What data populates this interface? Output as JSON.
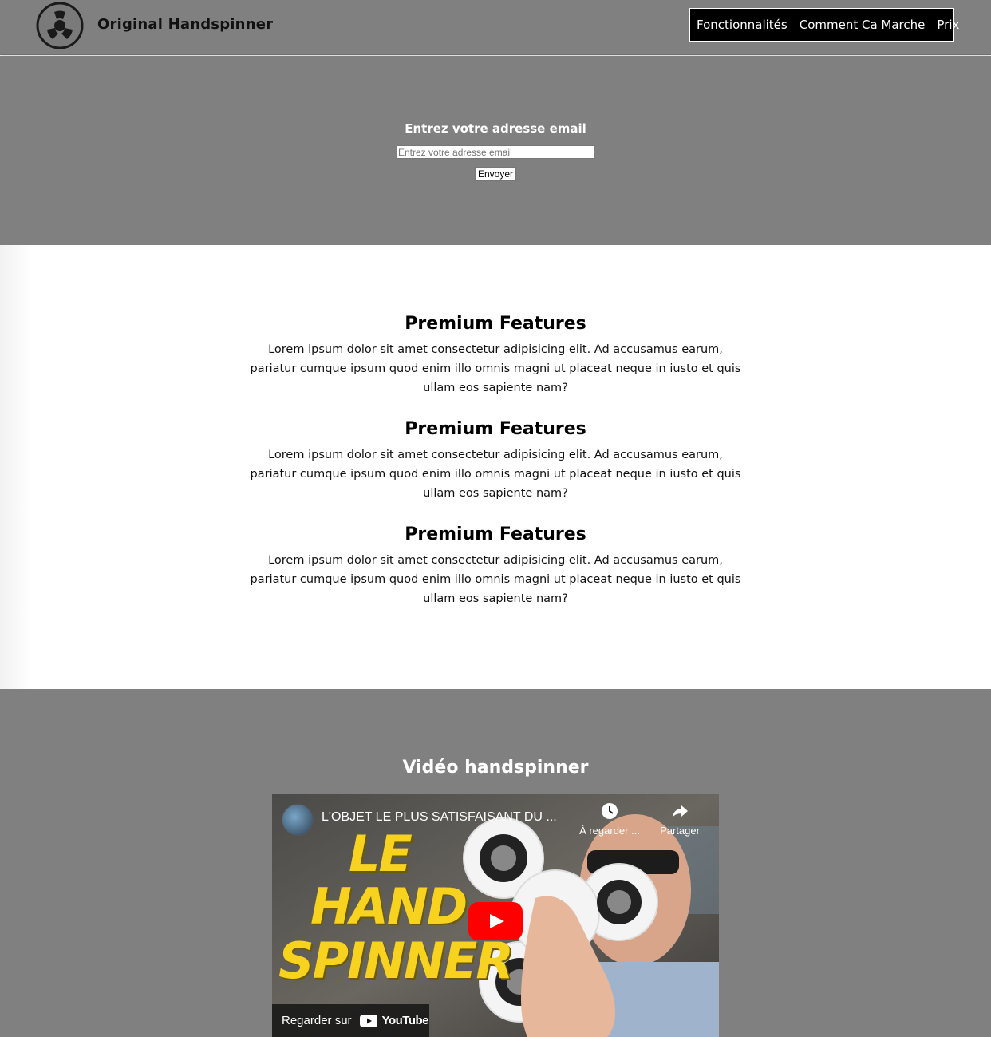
{
  "header": {
    "brand": "Original Handspinner",
    "nav": [
      "Fonctionnalités",
      "Comment Ca Marche",
      "Prix"
    ]
  },
  "hero": {
    "label": "Entrez votre adresse email",
    "input_placeholder": "Entrez votre adresse email",
    "submit_label": "Envoyer"
  },
  "features": [
    {
      "title": "Premium Features",
      "text": "Lorem ipsum dolor sit amet consectetur adipisicing elit. Ad accusamus earum, pariatur cumque ipsum quod enim illo omnis magni ut placeat neque in iusto et quis ullam eos sapiente nam?"
    },
    {
      "title": "Premium Features",
      "text": "Lorem ipsum dolor sit amet consectetur adipisicing elit. Ad accusamus earum, pariatur cumque ipsum quod enim illo omnis magni ut placeat neque in iusto et quis ullam eos sapiente nam?"
    },
    {
      "title": "Premium Features",
      "text": "Lorem ipsum dolor sit amet consectetur adipisicing elit. Ad accusamus earum, pariatur cumque ipsum quod enim illo omnis magni ut placeat neque in iusto et quis ullam eos sapiente nam?"
    }
  ],
  "video_section": {
    "title": "Vidéo handspinner",
    "video": {
      "title": "L'OBJET LE PLUS SATISFAISANT DU ...",
      "watch_later": "À regarder ...",
      "share": "Partager",
      "thumbnail_text": [
        "LE",
        "HAND",
        "SPINNER"
      ],
      "watch_on": "Regarder sur",
      "platform": "YouTube"
    }
  },
  "colors": {
    "section_gray": "#808080",
    "nav_bg": "#000000",
    "thumbnail_yellow": "#f7d21e",
    "youtube_red": "#ff0000"
  },
  "icons": [
    "handspinner-logo-icon",
    "clock-icon",
    "share-icon",
    "play-icon",
    "youtube-logo-icon"
  ]
}
